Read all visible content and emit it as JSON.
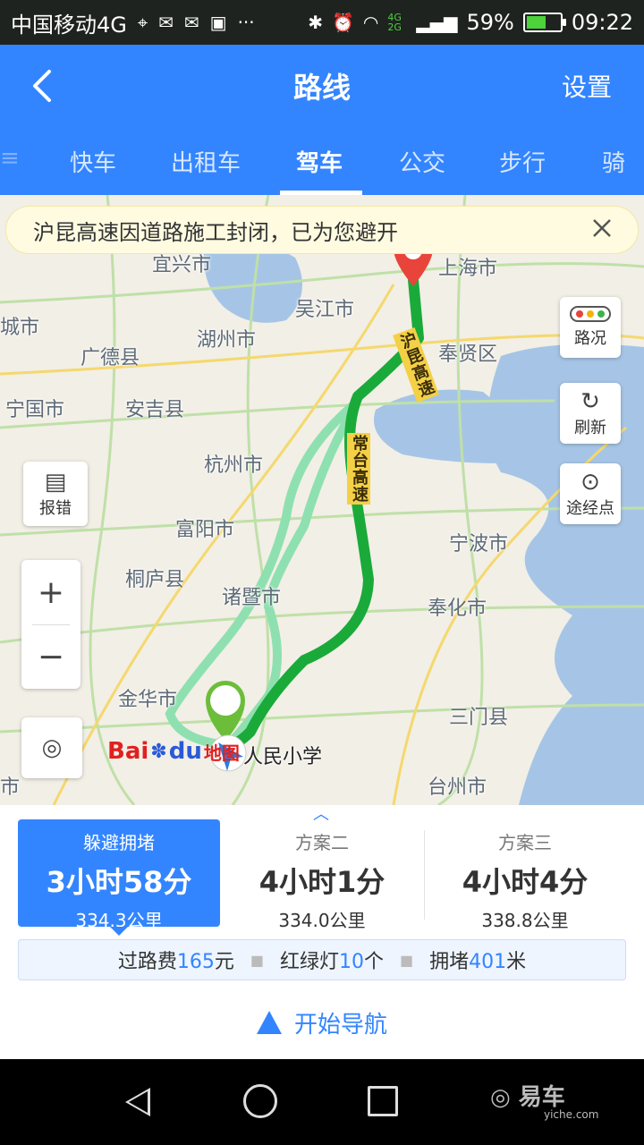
{
  "status_bar": {
    "carrier": "中国移动4G",
    "network": "4G 2G",
    "battery": "59%",
    "battery_level": 0.59,
    "time": "09:22"
  },
  "header": {
    "title": "路线",
    "settings_label": "设置",
    "tabs": [
      {
        "label": "快车"
      },
      {
        "label": "出租车"
      },
      {
        "label": "驾车",
        "active": true
      },
      {
        "label": "公交"
      },
      {
        "label": "步行"
      },
      {
        "label": "骑"
      }
    ]
  },
  "map": {
    "notice": "沪昆高速因道路施工封闭，已为您避开",
    "places": [
      "宜兴市",
      "湖州市",
      "吴江市",
      "上海市",
      "广德县",
      "奉贤区",
      "宁国市",
      "安吉县",
      "杭州市",
      "富阳市",
      "宁波市",
      "桐庐县",
      "诸暨市",
      "奉化市",
      "金华市",
      "三门县",
      "台州市",
      "人民小学",
      "城市",
      "市"
    ],
    "road_labels": [
      "沪昆高速",
      "常台高速"
    ],
    "start_marker": "起",
    "controls": {
      "traffic": "路况",
      "refresh": "刷新",
      "waypoint": "途经点",
      "report": "报错"
    },
    "logo": {
      "bai": "Bai",
      "du": "du",
      "ditu": "地图"
    },
    "colors": {
      "selected_route": "#1aaa3a",
      "alt_route": "#8fe0b0",
      "water": "#a6c5e6"
    }
  },
  "plans": [
    {
      "name": "躲避拥堵",
      "time": "3小时58分",
      "distance": "334.3公里",
      "selected": true
    },
    {
      "name": "方案二",
      "time": "4小时1分",
      "distance": "334.0公里"
    },
    {
      "name": "方案三",
      "time": "4小时4分",
      "distance": "338.8公里"
    }
  ],
  "stats": {
    "toll_label": "过路费",
    "toll_value": "165",
    "toll_unit": "元",
    "lights_label": "红绿灯",
    "lights_value": "10",
    "lights_unit": "个",
    "jam_label": "拥堵",
    "jam_value": "401",
    "jam_unit": "米"
  },
  "start_nav": "开始导航",
  "watermark": {
    "brand": "易车",
    "site": "yiche.com"
  },
  "accent_color": "#3385ff"
}
